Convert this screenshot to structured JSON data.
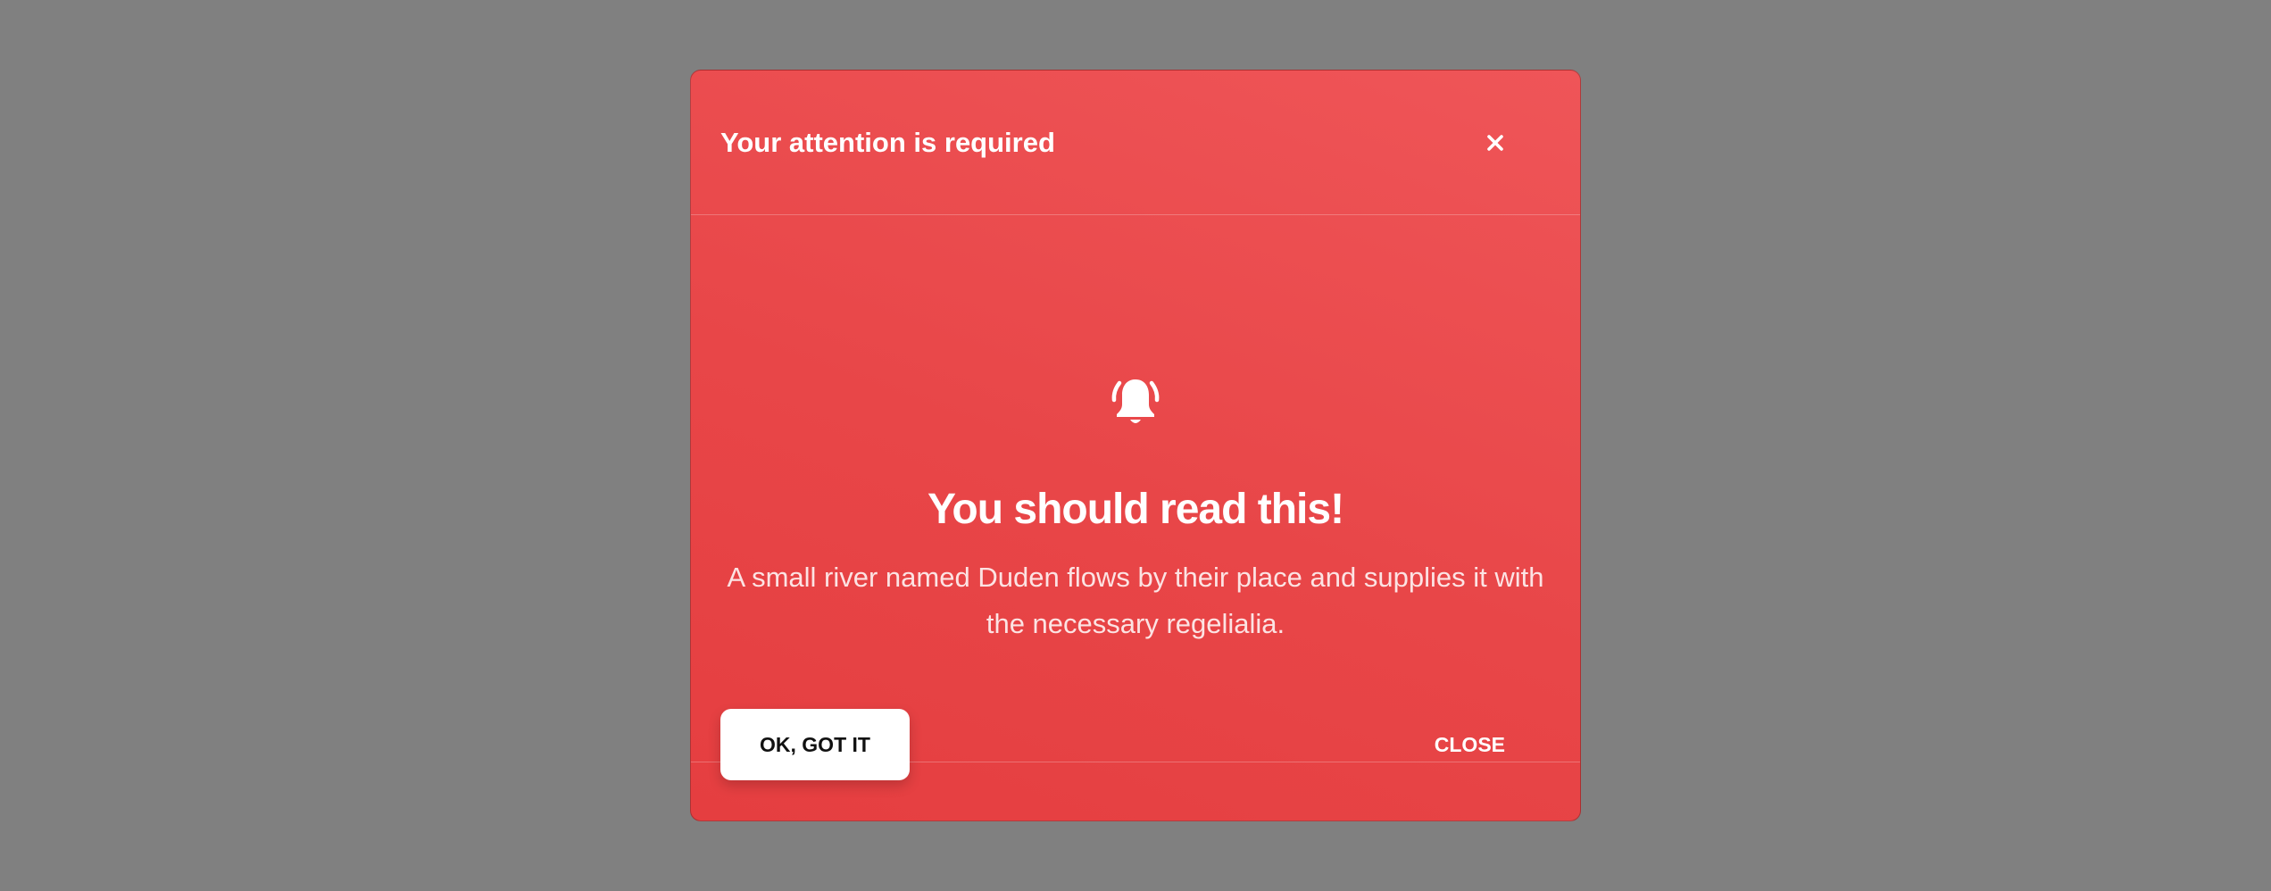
{
  "modal": {
    "title": "Your attention is required",
    "close_icon": "close-icon",
    "body_icon": "bell-ring-icon",
    "headline": "You should read this!",
    "message": "A small river named Duden flows by their place and supplies it with the necessary regelialia."
  },
  "footer": {
    "primary_label": "OK, GOT IT",
    "secondary_label": "CLOSE"
  },
  "colors": {
    "backdrop": "#808080",
    "modal_top": "#ef5558",
    "modal_bottom": "#e53e40",
    "text": "#ffffff",
    "button_bg": "#ffffff",
    "button_text": "#111111"
  }
}
